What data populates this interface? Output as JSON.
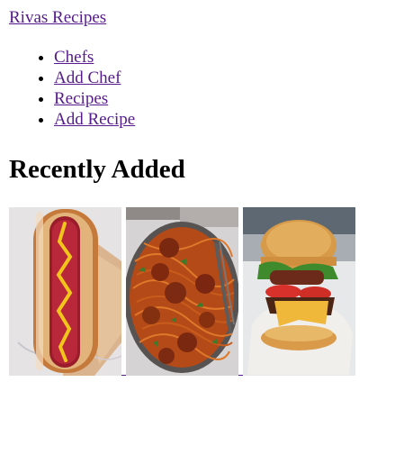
{
  "header": {
    "brand": "Rivas Recipes"
  },
  "nav": {
    "items": [
      "Chefs",
      "Add Chef",
      "Recipes",
      "Add Recipe"
    ]
  },
  "main": {
    "heading": "Recently Added",
    "recipes": [
      {
        "image": "hot-dog-photo"
      },
      {
        "image": "spaghetti-meatballs-photo"
      },
      {
        "image": "cheeseburger-photo"
      }
    ]
  },
  "colors": {
    "link": "#551a8b",
    "text": "#000000",
    "background": "#ffffff"
  }
}
